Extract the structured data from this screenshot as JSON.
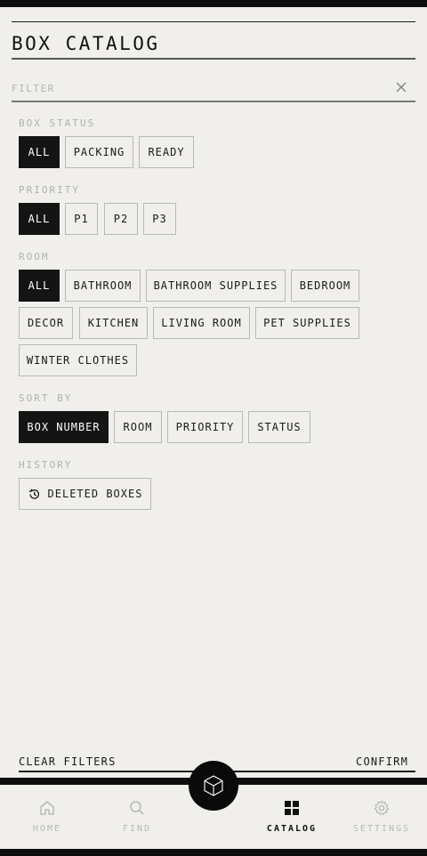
{
  "header": {
    "title": "BOX CATALOG"
  },
  "filter": {
    "placeholder": "FILTER",
    "value": ""
  },
  "sections": {
    "box_status": {
      "label": "BOX STATUS",
      "chips": [
        "ALL",
        "PACKING",
        "READY"
      ],
      "selected": "ALL"
    },
    "priority": {
      "label": "PRIORITY",
      "chips": [
        "ALL",
        "P1",
        "P2",
        "P3"
      ],
      "selected": "ALL"
    },
    "room": {
      "label": "ROOM",
      "chips": [
        "ALL",
        "BATHROOM",
        "BATHROOM SUPPLIES",
        "BEDROOM",
        "DECOR",
        "KITCHEN",
        "LIVING ROOM",
        "PET SUPPLIES",
        "WINTER CLOTHES"
      ],
      "selected": "ALL"
    },
    "sort_by": {
      "label": "SORT BY",
      "chips": [
        "BOX NUMBER",
        "ROOM",
        "PRIORITY",
        "STATUS"
      ],
      "selected": "BOX NUMBER"
    },
    "history": {
      "label": "HISTORY",
      "deleted_boxes": "DELETED BOXES"
    }
  },
  "actions": {
    "clear_filters": "CLEAR FILTERS",
    "confirm": "CONFIRM"
  },
  "nav": {
    "items": [
      {
        "label": "HOME",
        "icon": "home-icon"
      },
      {
        "label": "FIND",
        "icon": "search-icon"
      },
      {
        "label": "CATALOG",
        "icon": "catalog-grid-icon"
      },
      {
        "label": "SETTINGS",
        "icon": "gear-icon"
      }
    ],
    "active": "CATALOG",
    "fab_icon": "box-cube-icon"
  },
  "colors": {
    "background": "#f0efeb",
    "active_chip": "#141414",
    "inactive_text": "#b8b8b8"
  }
}
